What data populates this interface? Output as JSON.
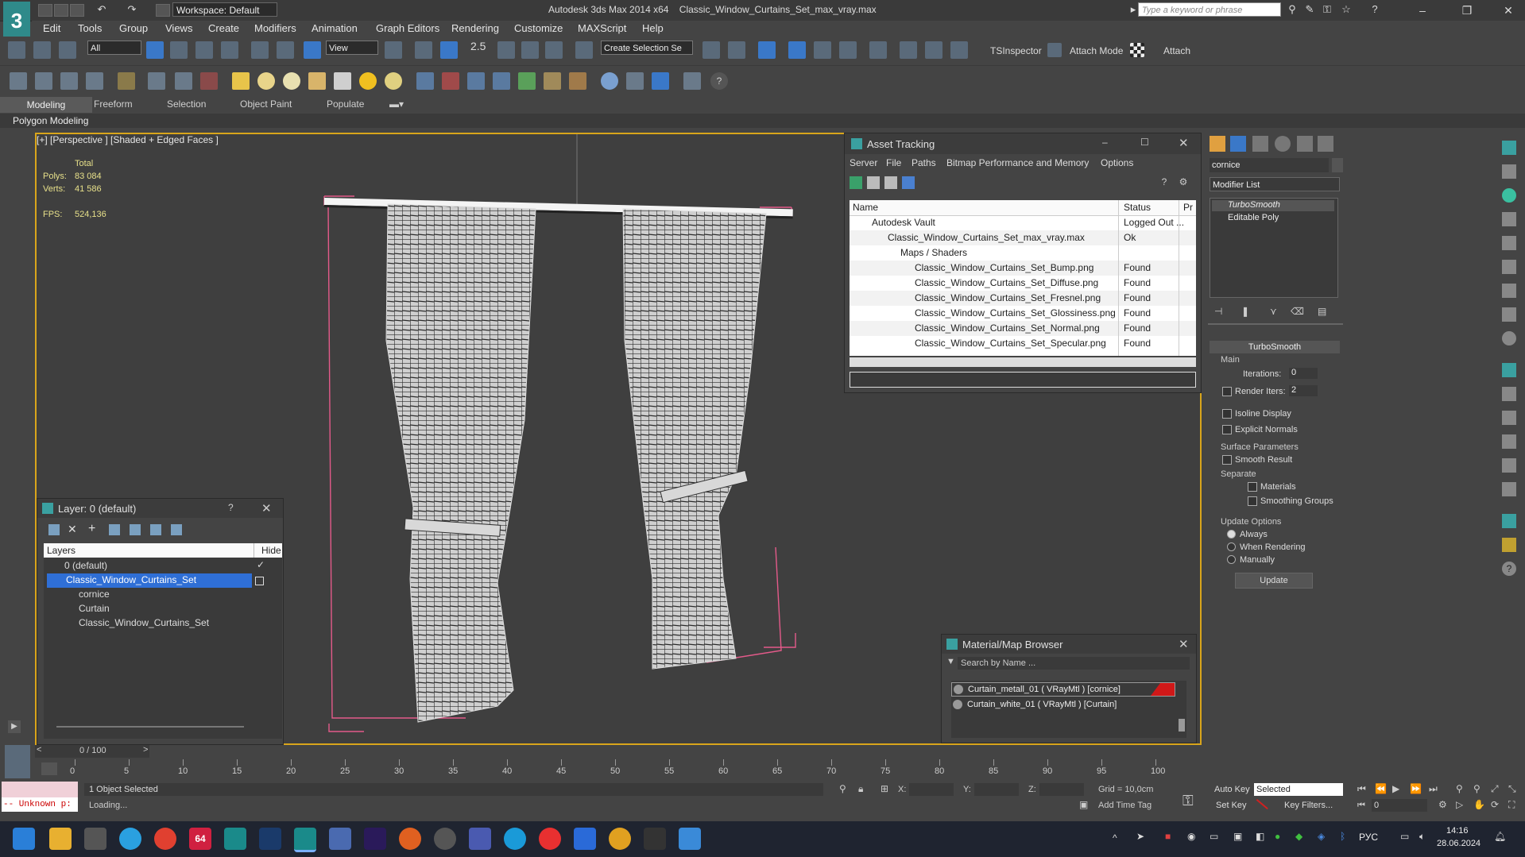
{
  "title_bar": {
    "workspace": "Workspace: Default",
    "app_title": "Autodesk 3ds Max  2014 x64",
    "file_title": "Classic_Window_Curtains_Set_max_vray.max",
    "search_placeholder": "Type a keyword or phrase"
  },
  "menu": [
    "Edit",
    "Tools",
    "Group",
    "Views",
    "Create",
    "Modifiers",
    "Animation",
    "Graph Editors",
    "Rendering",
    "Customize",
    "MAXScript",
    "Help"
  ],
  "toolbar": {
    "filter_select": "All",
    "ref_coord": "View",
    "snap_label": "2.5",
    "named_sel": "Create Selection Se",
    "tsinspector": "TSInspector",
    "attach_mode": "Attach Mode",
    "attach": "Attach"
  },
  "ribbon": {
    "tabs": [
      "Modeling",
      "Freeform",
      "Selection",
      "Object Paint",
      "Populate"
    ],
    "sub": "Polygon Modeling"
  },
  "viewport": {
    "label": "[+] [Perspective ] [Shaded + Edged Faces ]",
    "stats": {
      "total_label": "Total",
      "polys_label": "Polys:",
      "polys": "83 084",
      "verts_label": "Verts:",
      "verts": "41 586",
      "fps_label": "FPS:",
      "fps": "524,136"
    }
  },
  "asset_tracking": {
    "title": "Asset Tracking",
    "menu": [
      "Server",
      "File",
      "Paths",
      "Bitmap Performance and Memory",
      "Options"
    ],
    "columns": [
      "Name",
      "Status",
      "Pr"
    ],
    "rows": [
      {
        "name": "Autodesk Vault",
        "status": "Logged Out ..."
      },
      {
        "name": "Classic_Window_Curtains_Set_max_vray.max",
        "status": "Ok"
      },
      {
        "name": "Maps / Shaders",
        "status": ""
      },
      {
        "name": "Classic_Window_Curtains_Set_Bump.png",
        "status": "Found"
      },
      {
        "name": "Classic_Window_Curtains_Set_Diffuse.png",
        "status": "Found"
      },
      {
        "name": "Classic_Window_Curtains_Set_Fresnel.png",
        "status": "Found"
      },
      {
        "name": "Classic_Window_Curtains_Set_Glossiness.png",
        "status": "Found"
      },
      {
        "name": "Classic_Window_Curtains_Set_Normal.png",
        "status": "Found"
      },
      {
        "name": "Classic_Window_Curtains_Set_Specular.png",
        "status": "Found"
      }
    ]
  },
  "command_panel": {
    "object_name": "cornice",
    "modifier_list": "Modifier List",
    "stack": [
      "TurboSmooth",
      "Editable Poly"
    ],
    "rollout_title": "TurboSmooth",
    "main_label": "Main",
    "iterations_label": "Iterations:",
    "iterations": "0",
    "render_iters_label": "Render Iters:",
    "render_iters": "2",
    "isoline": "Isoline Display",
    "explicit_normals": "Explicit Normals",
    "surface_params": "Surface Parameters",
    "smooth_result": "Smooth Result",
    "separate": "Separate",
    "materials": "Materials",
    "smoothing_groups": "Smoothing Groups",
    "update_options": "Update Options",
    "always": "Always",
    "when_rendering": "When Rendering",
    "manually": "Manually",
    "update_button": "Update"
  },
  "layer_dialog": {
    "title": "Layer: 0 (default)",
    "help": "?",
    "col_layers": "Layers",
    "col_hide": "Hide",
    "rows": [
      "0 (default)",
      "Classic_Window_Curtains_Set",
      "cornice",
      "Curtain",
      "Classic_Window_Curtains_Set"
    ]
  },
  "material_browser": {
    "title": "Material/Map Browser",
    "search_placeholder": "Search by Name ...",
    "items": [
      "Curtain_metall_01  ( VRayMtl ) [cornice]",
      "Curtain_white_01  ( VRayMtl ) [Curtain]"
    ]
  },
  "timeline": {
    "frame": "0 / 100",
    "ticks": [
      "0",
      "5",
      "10",
      "15",
      "20",
      "25",
      "30",
      "35",
      "40",
      "45",
      "50",
      "55",
      "60",
      "65",
      "70",
      "75",
      "80",
      "85",
      "90",
      "95",
      "100"
    ]
  },
  "status": {
    "script_listener": "-- Unknown p:",
    "selected": "1 Object Selected",
    "loading": "Loading...",
    "x_label": "X:",
    "y_label": "Y:",
    "z_label": "Z:",
    "grid": "Grid = 10,0cm",
    "add_time_tag": "Add Time Tag",
    "auto_key": "Auto Key",
    "set_key": "Set Key",
    "selected_dropdown": "Selected",
    "key_filters": "Key Filters...",
    "frame_field": "0"
  },
  "taskbar": {
    "lang": "РУС",
    "time": "14:16",
    "date": "28.06.2024",
    "badge": "64"
  },
  "colors": {
    "viewport_border": "#d9a51b",
    "selection": "#2f6fd6",
    "wire": "#e45a8a"
  }
}
